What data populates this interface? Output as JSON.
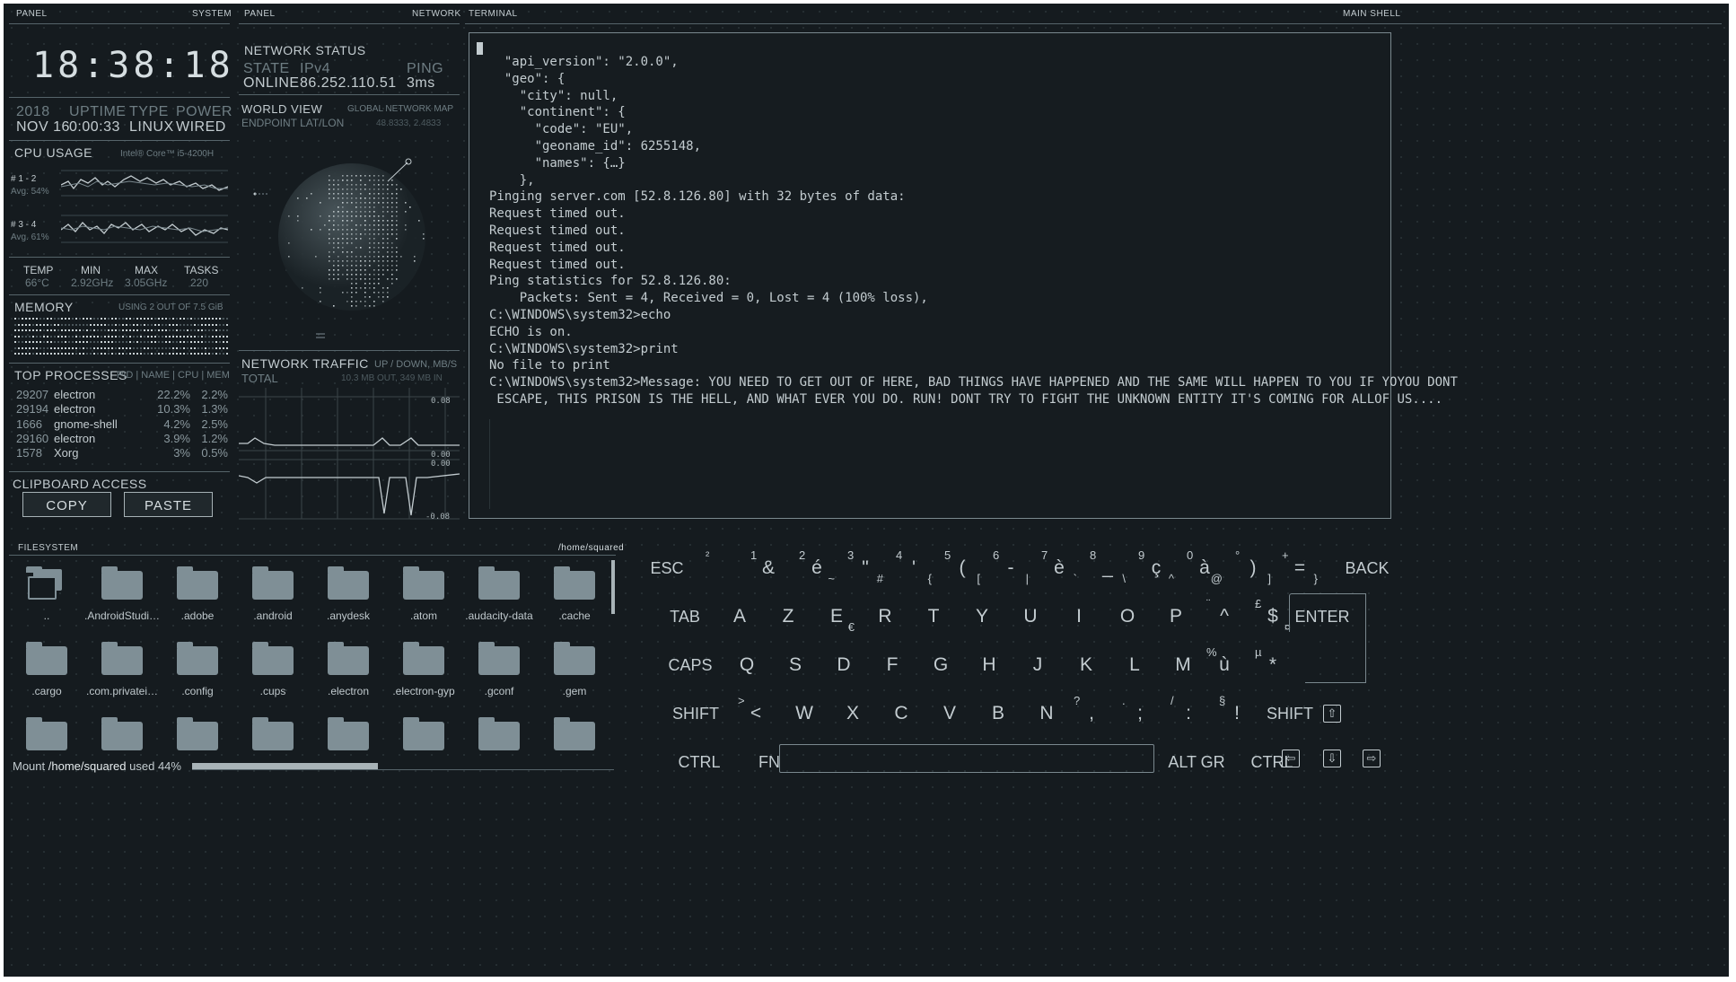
{
  "headers": {
    "panel_left": "PANEL",
    "system": "SYSTEM",
    "panel_mid": "PANEL",
    "network": "NETWORK",
    "terminal": "TERMINAL",
    "main_shell": "MAIN SHELL",
    "filesystem": "FILESYSTEM",
    "fs_path": "/home/squared"
  },
  "clock": {
    "time": "18:38:18"
  },
  "sysinfo": {
    "year": "2018",
    "date": "NOV 16",
    "uptime_label": "UPTIME",
    "uptime": "0:00:33",
    "type_label": "TYPE",
    "type": "LINUX",
    "power_label": "POWER",
    "power": "WIRED"
  },
  "cpu": {
    "title": "CPU USAGE",
    "model": "Intel® Core™ i5-4200H",
    "core1_label": "# 1 - 2",
    "core1_avg": "Avg. 54%",
    "core2_label": "# 3 - 4",
    "core2_avg": "Avg. 61%",
    "temp_label": "TEMP",
    "temp": "66°C",
    "min_label": "MIN",
    "min": "2.92GHz",
    "max_label": "MAX",
    "max": "3.05GHz",
    "tasks_label": "TASKS",
    "tasks": "220"
  },
  "memory": {
    "title": "MEMORY",
    "usage": "USING 2 OUT OF 7.5 GiB"
  },
  "processes": {
    "title": "TOP PROCESSES",
    "cols": "PID | NAME | CPU | MEM",
    "rows": [
      {
        "pid": "29207",
        "name": "electron",
        "cpu": "22.2%",
        "mem": "2.2%"
      },
      {
        "pid": "29194",
        "name": "electron",
        "cpu": "10.3%",
        "mem": "1.3%"
      },
      {
        "pid": "1666",
        "name": "gnome-shell",
        "cpu": "4.2%",
        "mem": "2.5%"
      },
      {
        "pid": "29160",
        "name": "electron",
        "cpu": "3.9%",
        "mem": "1.2%"
      },
      {
        "pid": "1578",
        "name": "Xorg",
        "cpu": "3%",
        "mem": "0.5%"
      }
    ]
  },
  "clipboard": {
    "title": "CLIPBOARD ACCESS",
    "copy": "COPY",
    "paste": "PASTE"
  },
  "netstatus": {
    "title": "NETWORK STATUS",
    "state_label": "STATE",
    "state": "ONLINE",
    "ip_label": "IPv4",
    "ip": "86.252.110.51",
    "ping_label": "PING",
    "ping": "3ms"
  },
  "worldview": {
    "title": "WORLD VIEW",
    "subtitle": "GLOBAL NETWORK MAP",
    "endpoint_label": "ENDPOINT LAT/LON",
    "endpoint": "48.8333, 2.4833"
  },
  "traffic": {
    "title": "NETWORK TRAFFIC",
    "units": "UP / DOWN, MB/S",
    "total_label": "TOTAL",
    "total": "10.3 MB OUT, 349 MB IN",
    "scale_top": "0.08",
    "scale_mid1": "0.00",
    "scale_mid2": "0.00",
    "scale_bot": "-0.08"
  },
  "terminal": {
    "lines": [
      "  \"api_version\": \"2.0.0\",",
      "  \"geo\": {",
      "    \"city\": null,",
      "    \"continent\": {",
      "      \"code\": \"EU\",",
      "      \"geoname_id\": 6255148,",
      "      \"names\": {…}",
      "    },",
      "Pinging server.com [52.8.126.80] with 32 bytes of data:",
      "Request timed out.",
      "Request timed out.",
      "Request timed out.",
      "Request timed out.",
      "",
      "Ping statistics for 52.8.126.80:",
      "    Packets: Sent = 4, Received = 0, Lost = 4 (100% loss),",
      "",
      "C:\\WINDOWS\\system32>echo",
      "ECHO is on.",
      "",
      "C:\\WINDOWS\\system32>print",
      "No file to print",
      "",
      "C:\\WINDOWS\\system32>Message: YOU NEED TO GET OUT OF HERE, BAD THINGS HAVE HAPPENED AND THE SAME WILL HAPPEN TO YOU IF YOYOU DONT",
      " ESCAPE, THIS PRISON IS THE HELL, AND WHAT EVER YOU DO. RUN! DONT TRY TO FIGHT THE UNKNOWN ENTITY IT'S COMING FOR ALLOF US...."
    ]
  },
  "filesystem": {
    "items": [
      "..",
      ".AndroidStudi…",
      ".adobe",
      ".android",
      ".anydesk",
      ".atom",
      ".audacity-data",
      ".cache",
      ".cargo",
      ".com.privatei…",
      ".config",
      ".cups",
      ".electron",
      ".electron-gyp",
      ".gconf",
      ".gem"
    ],
    "mount_prefix": "Mount",
    "mount_path": "/home/squared",
    "mount_used": "used",
    "mount_pct": "44%",
    "usage_fraction": 0.44
  },
  "keyboard": {
    "row1": [
      {
        "main": "ESC"
      },
      {
        "main": "",
        "top": "²"
      },
      {
        "main": "&",
        "top": "1"
      },
      {
        "main": "é",
        "top": "2",
        "sub": "~"
      },
      {
        "main": "\"",
        "top": "3",
        "sub": "#"
      },
      {
        "main": "'",
        "top": "4",
        "sub": "{"
      },
      {
        "main": "(",
        "top": "5",
        "sub": "["
      },
      {
        "main": "-",
        "top": "6",
        "sub": "|"
      },
      {
        "main": "è",
        "top": "7",
        "sub": "`"
      },
      {
        "main": "_",
        "top": "8",
        "sub": "\\"
      },
      {
        "main": "ç",
        "top": "9",
        "sub": "^"
      },
      {
        "main": "à",
        "top": "0",
        "sub": "@"
      },
      {
        "main": ")",
        "top": "°",
        "sub": "]"
      },
      {
        "main": "=",
        "top": "+",
        "sub": "}"
      },
      {
        "main": "BACK"
      }
    ],
    "row2": [
      {
        "main": "TAB"
      },
      {
        "main": "A"
      },
      {
        "main": "Z"
      },
      {
        "main": "E",
        "sub": "€"
      },
      {
        "main": "R"
      },
      {
        "main": "T"
      },
      {
        "main": "Y"
      },
      {
        "main": "U"
      },
      {
        "main": "I"
      },
      {
        "main": "O"
      },
      {
        "main": "P"
      },
      {
        "main": "^",
        "top": "¨"
      },
      {
        "main": "$",
        "top": "£",
        "sub": "¤"
      },
      {
        "main": "ENTER"
      }
    ],
    "row3": [
      {
        "main": "CAPS"
      },
      {
        "main": "Q"
      },
      {
        "main": "S"
      },
      {
        "main": "D"
      },
      {
        "main": "F"
      },
      {
        "main": "G"
      },
      {
        "main": "H"
      },
      {
        "main": "J"
      },
      {
        "main": "K"
      },
      {
        "main": "L"
      },
      {
        "main": "M"
      },
      {
        "main": "ù",
        "top": "%"
      },
      {
        "main": "*",
        "top": "µ"
      }
    ],
    "row4": [
      {
        "main": "SHIFT"
      },
      {
        "main": "<",
        "top": ">"
      },
      {
        "main": "W"
      },
      {
        "main": "X"
      },
      {
        "main": "C"
      },
      {
        "main": "V"
      },
      {
        "main": "B"
      },
      {
        "main": "N"
      },
      {
        "main": ",",
        "top": "?"
      },
      {
        "main": ";",
        "top": "."
      },
      {
        "main": ":",
        "top": "/"
      },
      {
        "main": "!",
        "top": "§"
      },
      {
        "main": "SHIFT"
      }
    ],
    "row5": [
      {
        "main": "CTRL"
      },
      {
        "main": "FN"
      },
      {
        "main": "ALT GR"
      },
      {
        "main": "CTRL"
      }
    ]
  }
}
